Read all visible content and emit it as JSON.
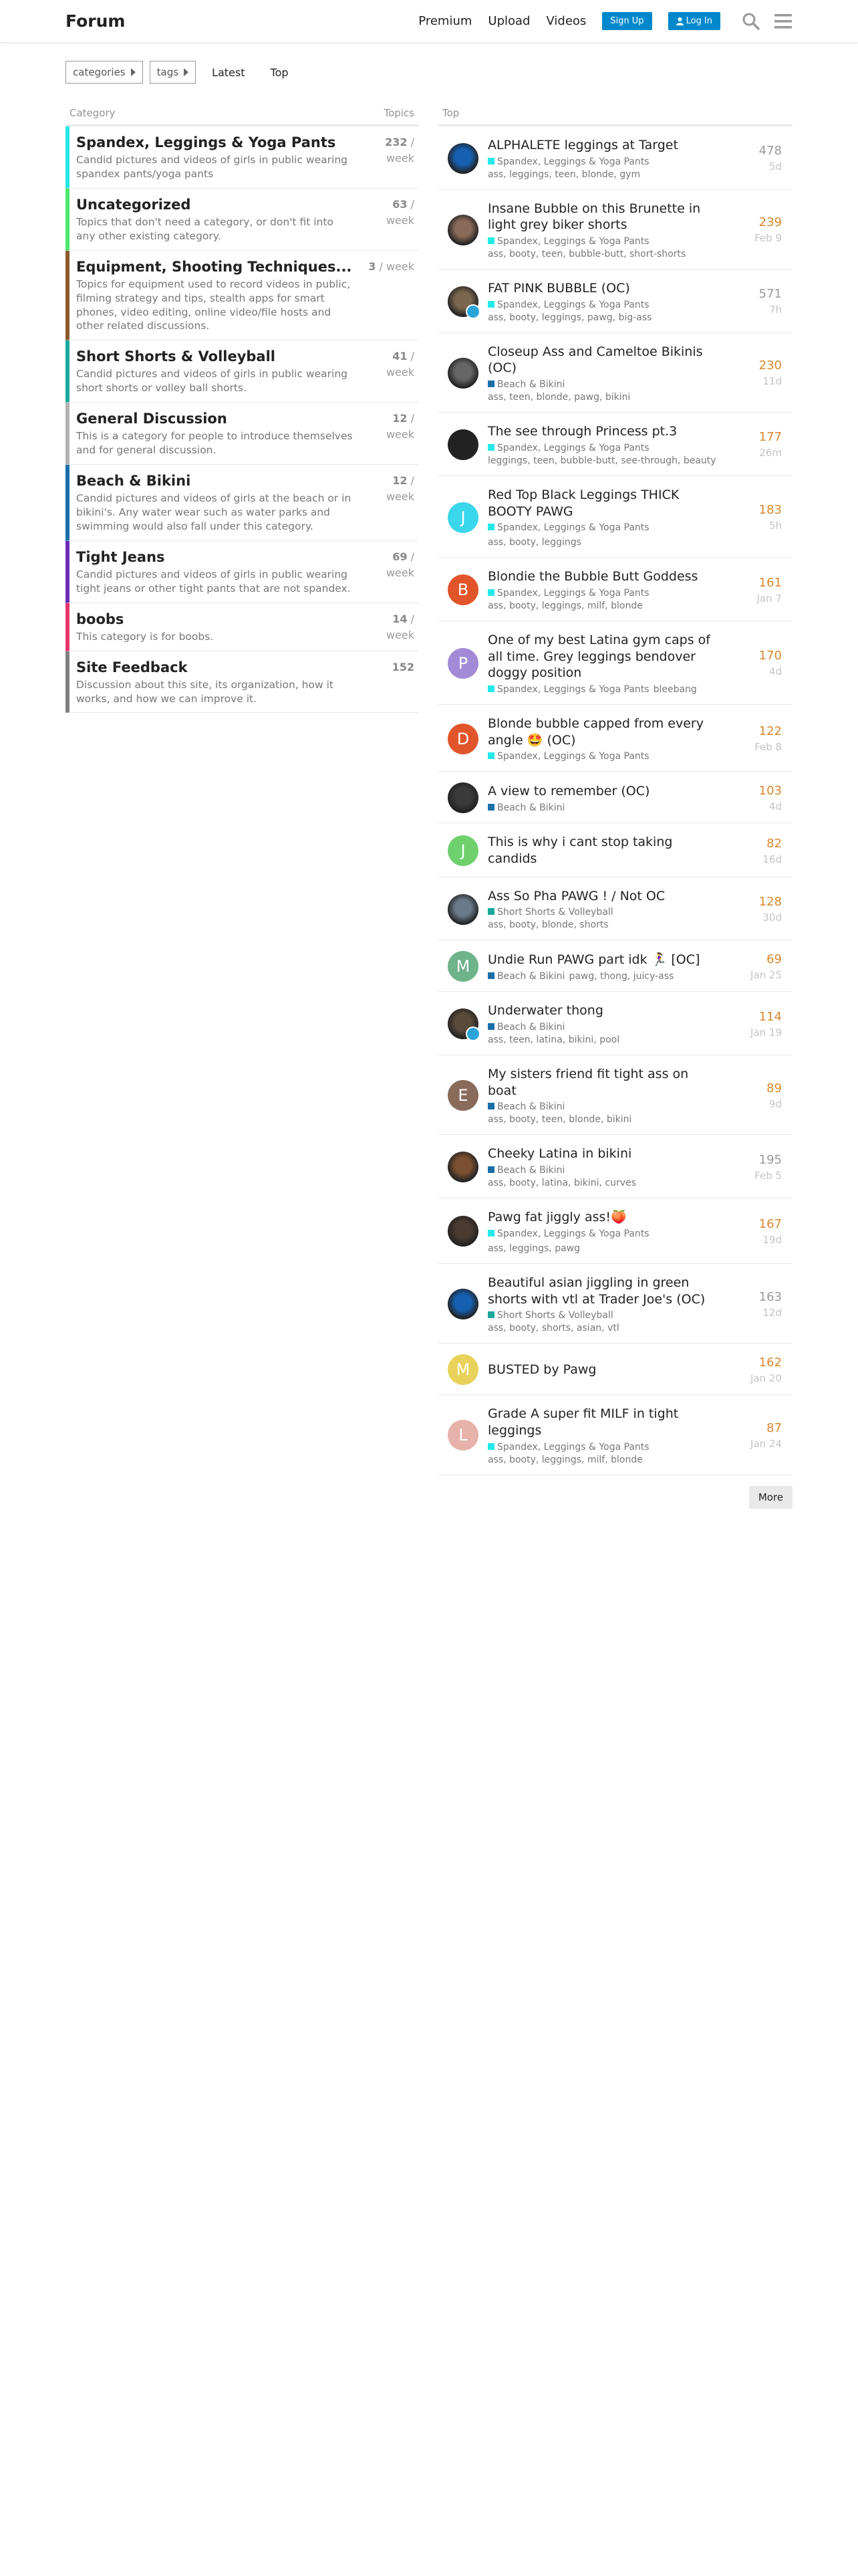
{
  "header": {
    "logo": "Forum",
    "nav": [
      "Premium",
      "Upload",
      "Videos"
    ],
    "signup": "Sign Up",
    "login": "Log In"
  },
  "toolbar": {
    "categories": "categories",
    "tags": "tags",
    "latest": "Latest",
    "top": "Top"
  },
  "left": {
    "heading_category": "Category",
    "heading_topics": "Topics",
    "categories": [
      {
        "name": "Spandex, Leggings & Yoga Pants",
        "desc": "Candid pictures and videos of girls in public wearing spandex pants/yoga pants",
        "count": "232",
        "unit": "/ week",
        "color": "#25e8e8"
      },
      {
        "name": "Uncategorized",
        "desc": "Topics that don't need a category, or don't fit into any other existing category.",
        "count": "63",
        "unit": "/ week",
        "color": "#4be86b"
      },
      {
        "name": "Equipment, Shooting Techniques...",
        "desc": "Topics for equipment used to record videos in public, filming strategy and tips, stealth apps for smart phones, video editing, online video/file hosts and other related discussions.",
        "count": "3",
        "unit": "/ week",
        "color": "#8b5a2b"
      },
      {
        "name": "Short Shorts & Volleyball",
        "desc": "Candid pictures and videos of girls in public wearing short shorts or volley ball shorts.",
        "count": "41",
        "unit": "/ week",
        "color": "#1aa89a"
      },
      {
        "name": "General Discussion",
        "desc": "This is a category for people to introduce themselves and for general discussion.",
        "count": "12",
        "unit": "/ week",
        "color": "#b3b3b3"
      },
      {
        "name": "Beach & Bikini",
        "desc": "Candid pictures and videos of girls at the beach or in bikini's. Any water wear such as water parks and swimming would also fall under this category.",
        "count": "12",
        "unit": "/ week",
        "color": "#1a6fa8"
      },
      {
        "name": "Tight Jeans",
        "desc": "Candid pictures and videos of girls in public wearing tight jeans or other tight pants that are not spandex.",
        "count": "69",
        "unit": "/ week",
        "color": "#6c2bb5"
      },
      {
        "name": "boobs",
        "desc": "This category is for boobs.",
        "count": "14",
        "unit": "/ week",
        "color": "#e8336d"
      },
      {
        "name": "Site Feedback",
        "desc": "Discussion about this site, its organization, how it works, and how we can improve it.",
        "count": "152",
        "unit": "",
        "color": "#808080"
      }
    ]
  },
  "right": {
    "heading": "Top",
    "topics": [
      {
        "title": "ALPHALETE leggings at Target",
        "cat": "Spandex, Leggings & Yoga Pants",
        "catcolor": "#25e8e8",
        "tags": "ass, leggings, teen, blonde, gym",
        "count": "478",
        "hot": false,
        "date": "5d",
        "av": "#1560b0",
        "letter": "",
        "badge": false
      },
      {
        "title": "Insane Bubble on this Brunette in light grey biker shorts",
        "cat": "Spandex, Leggings & Yoga Pants",
        "catcolor": "#25e8e8",
        "tags": "ass, booty, teen, bubble-butt, short-shorts",
        "count": "239",
        "hot": true,
        "date": "Feb 9",
        "av": "#8a6a58",
        "letter": "",
        "badge": false
      },
      {
        "title": "FAT PINK BUBBLE (OC)",
        "cat": "Spandex, Leggings & Yoga Pants",
        "catcolor": "#25e8e8",
        "tags": "ass, booty, leggings, pawg, big-ass",
        "count": "571",
        "hot": false,
        "date": "7h",
        "av": "#7c6650",
        "letter": "",
        "badge": true
      },
      {
        "title": "Closeup Ass and Cameltoe Bikinis (OC)",
        "cat": "Beach & Bikini",
        "catcolor": "#1a6fa8",
        "tags": "ass, teen, blonde, pawg, bikini",
        "count": "230",
        "hot": true,
        "date": "11d",
        "av": "#666666",
        "letter": "",
        "badge": false
      },
      {
        "title": "The see through Princess pt.3",
        "cat": "Spandex, Leggings & Yoga Pants",
        "catcolor": "#25e8e8",
        "tags": "leggings, teen, bubble-butt, see-through, beauty",
        "count": "177",
        "hot": true,
        "date": "26m",
        "av": "#222222",
        "letter": "",
        "badge": false
      },
      {
        "title": "Red Top Black Leggings THICK BOOTY PAWG",
        "cat": "Spandex, Leggings & Yoga Pants",
        "catcolor": "#25e8e8",
        "tags": "ass, booty, leggings",
        "count": "183",
        "hot": true,
        "date": "5h",
        "av": "#3ad6ec",
        "letter": "J",
        "badge": false
      },
      {
        "title": "Blondie the Bubble Butt Goddess",
        "cat": "Spandex, Leggings & Yoga Pants",
        "catcolor": "#25e8e8",
        "tags": "ass, booty, leggings, milf, blonde",
        "count": "161",
        "hot": true,
        "date": "Jan 7",
        "av": "#e2552a",
        "letter": "B",
        "badge": false
      },
      {
        "title": "One of my best Latina gym caps of all time. Grey leggings bendover doggy position",
        "cat": "Spandex, Leggings & Yoga Pants",
        "catcolor": "#25e8e8",
        "tags": "bleebang",
        "count": "170",
        "hot": true,
        "date": "4d",
        "av": "#a38ad6",
        "letter": "P",
        "badge": false
      },
      {
        "title": "Blonde bubble capped from every angle 🤩 (OC)",
        "cat": "Spandex, Leggings & Yoga Pants",
        "catcolor": "#25e8e8",
        "tags": "",
        "count": "122",
        "hot": true,
        "date": "Feb 8",
        "av": "#e2552a",
        "letter": "D",
        "badge": false
      },
      {
        "title": "A view to remember (OC)",
        "cat": "Beach & Bikini",
        "catcolor": "#1a6fa8",
        "tags": "",
        "count": "103",
        "hot": true,
        "date": "4d",
        "av": "#3a3a3a",
        "letter": "",
        "badge": false
      },
      {
        "title": "This is why i cant stop taking candids",
        "cat": "",
        "catcolor": "",
        "tags": "",
        "count": "82",
        "hot": true,
        "date": "16d",
        "av": "#6ed16e",
        "letter": "J",
        "badge": false
      },
      {
        "title": "Ass So Pha PAWG ! / Not OC",
        "cat": "Short Shorts & Volleyball",
        "catcolor": "#1aa89a",
        "tags": "ass, booty, blonde, shorts",
        "count": "128",
        "hot": true,
        "date": "30d",
        "av": "#6b7a8a",
        "letter": "",
        "badge": false
      },
      {
        "title": "Undie Run PAWG part idk 🏃‍♀️ [OC]",
        "cat": "Beach & Bikini",
        "catcolor": "#1a6fa8",
        "tags": "pawg, thong, juicy-ass",
        "count": "69",
        "hot": true,
        "date": "Jan 25",
        "av": "#6fb38a",
        "letter": "M",
        "badge": false
      },
      {
        "title": "Underwater thong",
        "cat": "Beach & Bikini",
        "catcolor": "#1a6fa8",
        "tags": "ass, teen, latina, bikini, pool",
        "count": "114",
        "hot": true,
        "date": "Jan 19",
        "av": "#5a4a3a",
        "letter": "",
        "badge": true
      },
      {
        "title": "My sisters friend fit tight ass on boat",
        "cat": "Beach & Bikini",
        "catcolor": "#1a6fa8",
        "tags": "ass, booty, teen, blonde, bikini",
        "count": "89",
        "hot": true,
        "date": "9d",
        "av": "#8a6a5a",
        "letter": "E",
        "badge": false
      },
      {
        "title": "Cheeky Latina in bikini",
        "cat": "Beach & Bikini",
        "catcolor": "#1a6fa8",
        "tags": "ass, booty, latina, bikini, curves",
        "count": "195",
        "hot": false,
        "date": "Feb 5",
        "av": "#7a5030",
        "letter": "",
        "badge": false
      },
      {
        "title": "Pawg fat jiggly ass!🍑",
        "cat": "Spandex, Leggings & Yoga Pants",
        "catcolor": "#25e8e8",
        "tags": "ass, leggings, pawg",
        "count": "167",
        "hot": true,
        "date": "19d",
        "av": "#4a3a30",
        "letter": "",
        "badge": false
      },
      {
        "title": "Beautiful asian jiggling in green shorts with vtl at Trader Joe's (OC)",
        "cat": "Short Shorts & Volleyball",
        "catcolor": "#1aa89a",
        "tags": "ass, booty, shorts, asian, vtl",
        "count": "163",
        "hot": false,
        "date": "12d",
        "av": "#1560b0",
        "letter": "",
        "badge": false
      },
      {
        "title": "BUSTED by Pawg",
        "cat": "",
        "catcolor": "",
        "tags": "",
        "count": "162",
        "hot": true,
        "date": "Jan 20",
        "av": "#e8d25a",
        "letter": "M",
        "badge": false
      },
      {
        "title": "Grade A super fit MILF in tight leggings",
        "cat": "Spandex, Leggings & Yoga Pants",
        "catcolor": "#25e8e8",
        "tags": "ass, booty, leggings, milf, blonde",
        "count": "87",
        "hot": true,
        "date": "Jan 24",
        "av": "#e6b2aa",
        "letter": "L",
        "badge": false
      }
    ],
    "more": "More"
  }
}
